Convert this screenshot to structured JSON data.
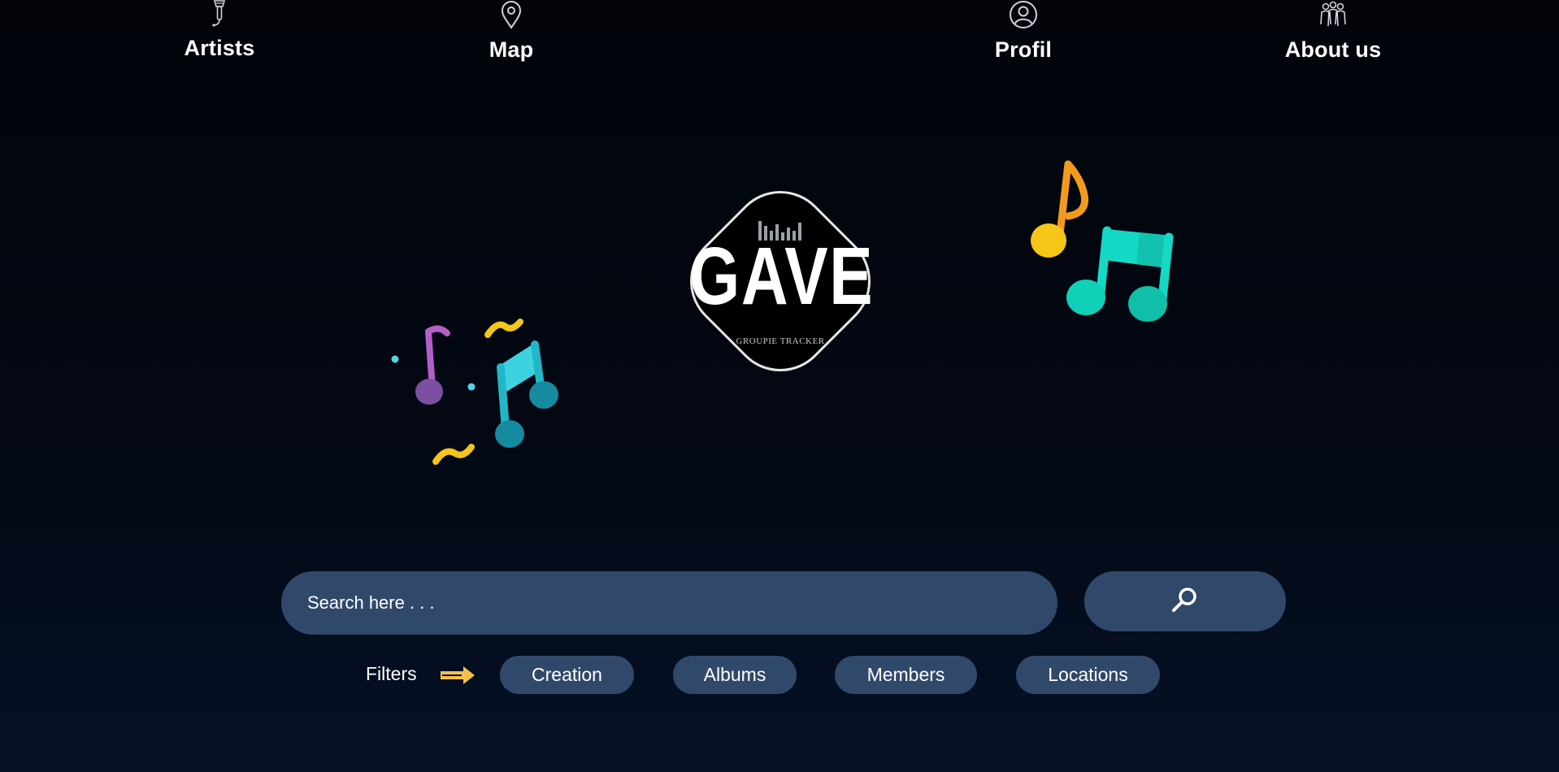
{
  "nav": {
    "items": [
      {
        "label": "Artists",
        "icon": "microphone-icon"
      },
      {
        "label": "Map",
        "icon": "map-pin-icon"
      },
      {
        "label": "Profil",
        "icon": "user-circle-icon"
      },
      {
        "label": "About us",
        "icon": "team-icon"
      }
    ]
  },
  "logo": {
    "title": "GAVE",
    "subtitle": "GROUPIE TRACKER"
  },
  "search": {
    "placeholder": "Search here . . .",
    "button_icon": "search-icon"
  },
  "filters": {
    "label": "Filters",
    "options": [
      "Creation",
      "Albums",
      "Members",
      "Locations"
    ]
  },
  "colors": {
    "background": "#030813",
    "control": "#30496b",
    "arrow": "#f2c14e",
    "note_purple": "#b35fc7",
    "note_teal": "#22b6c9",
    "note_orange": "#f39a1e",
    "note_yellow": "#f5c518",
    "note_green": "#14d9c4"
  }
}
